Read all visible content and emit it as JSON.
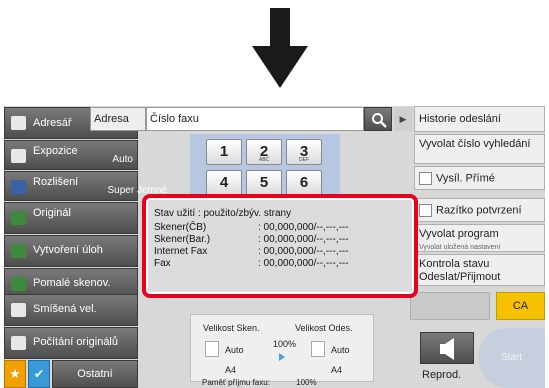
{
  "sidebar": {
    "addressbook": "Adresář",
    "exposure": {
      "label": "Expozice",
      "value": "Auto"
    },
    "resolution": {
      "label": "Rozlišení",
      "value": "Super Jemné"
    },
    "original": "Originál",
    "job_build": "Vytvoření úloh",
    "slow_scan": "Pomalé skenov.",
    "mixed_size": "Smíšená vel.",
    "count_originals": "Počítání originálů",
    "others": "Ostatní"
  },
  "header": {
    "address_tab": "Adresa",
    "fax_number": "Číslo faxu"
  },
  "keypad": {
    "keys": [
      {
        "digit": "1",
        "letters": ""
      },
      {
        "digit": "2",
        "letters": "ABC"
      },
      {
        "digit": "3",
        "letters": "DEF"
      },
      {
        "digit": "4",
        "letters": ""
      },
      {
        "digit": "5",
        "letters": ""
      },
      {
        "digit": "6",
        "letters": ""
      }
    ]
  },
  "right": {
    "send_history": "Historie odeslání",
    "recall_search": "Vyvolat číslo vyhledání",
    "direct_send": "Vysíl. Přímé",
    "confirm_stamp": "Razítko potvrzení",
    "recall_program": "Vyvolat program",
    "recall_program_sub": "Vyvolat uložená nastavení",
    "status_check": "Kontrola stavu Odeslat/Přijmout",
    "ca": "CA",
    "reprod": "Reprod.",
    "start": "Start"
  },
  "scan": {
    "scan_size_label": "Velikost Sken.",
    "send_size_label": "Velikost Odes.",
    "scan_auto": "Auto",
    "send_auto": "Auto",
    "ratio": "100%",
    "scan_paper": "A4",
    "send_paper": "A4",
    "memory_label": "Paměť příjmu faxu:",
    "memory_value": "100%"
  },
  "popup": {
    "title": "Stav užití  : použito/zbýv. strany",
    "rows": [
      {
        "label": "Skener(ČB)",
        "value": ": 00,000,000/--,---,---"
      },
      {
        "label": "Skener(Bar.)",
        "value": ": 00,000,000/--,---,---"
      },
      {
        "label": "Internet Fax",
        "value": ": 00,000,000/--,---,---"
      },
      {
        "label": "Fax",
        "value": ": 00,000,000/--,---,---"
      }
    ]
  },
  "colors": {
    "popup_border": "#e8001c",
    "ca_button": "#f6c100",
    "star_button": "#f2a000",
    "check_button": "#3a9ad8",
    "keypad_bg": "#b7c7e2"
  }
}
